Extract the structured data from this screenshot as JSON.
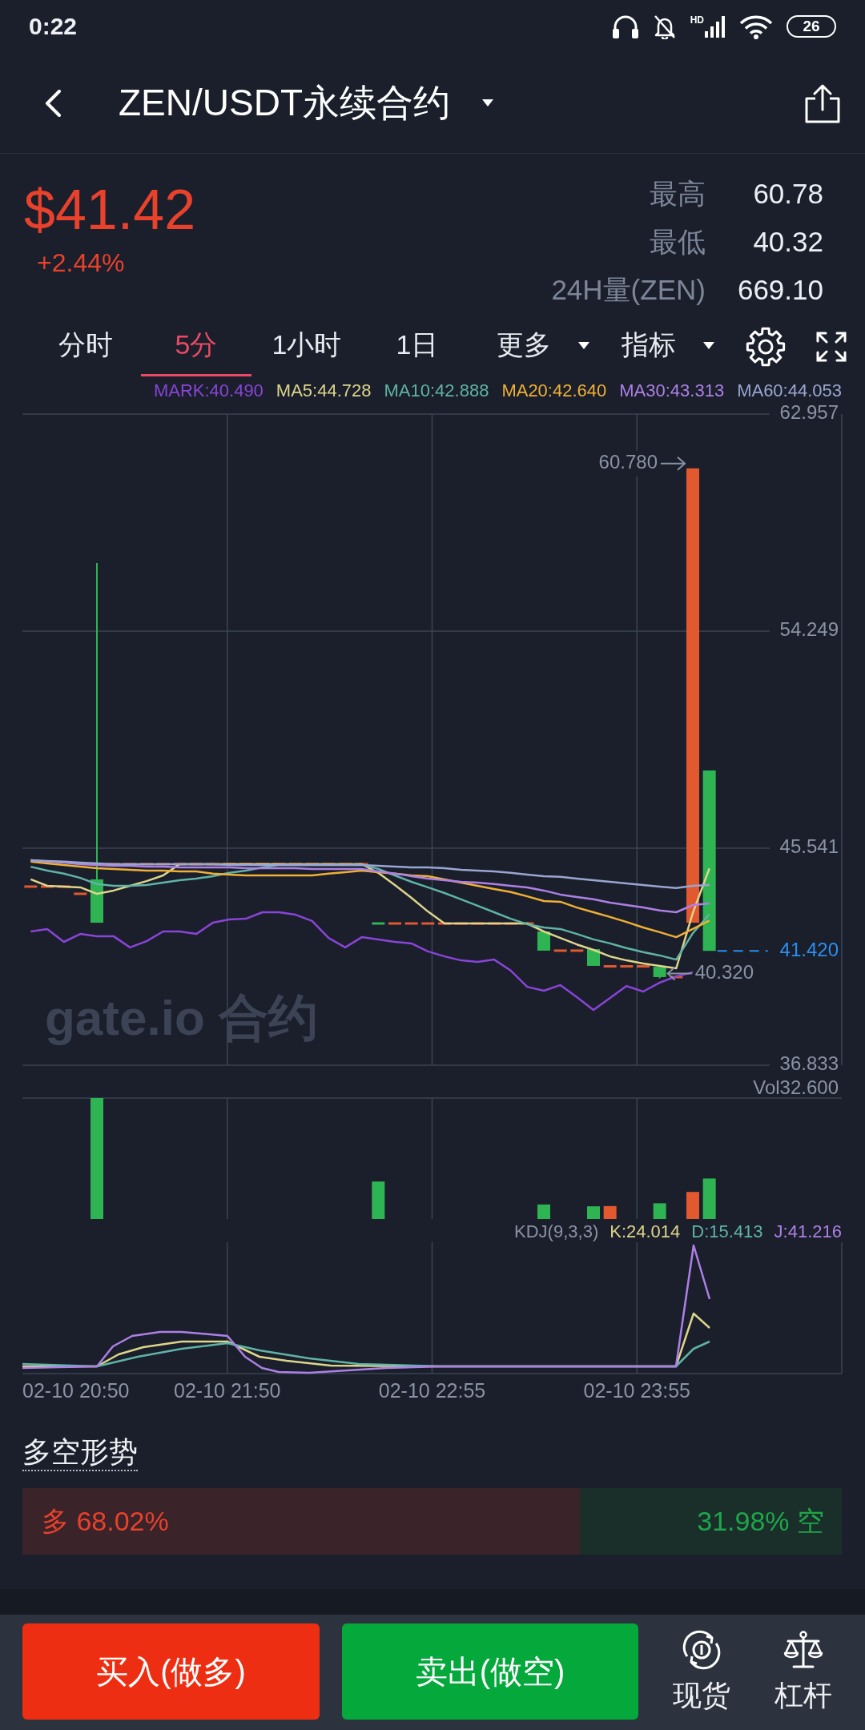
{
  "status_bar": {
    "time": "0:22",
    "network_label": "HD",
    "battery": "26"
  },
  "header": {
    "title": "ZEN/USDT永续合约"
  },
  "ticker": {
    "price": "$41.42",
    "change": "+2.44%",
    "stats": [
      {
        "label": "最高",
        "value": "60.78"
      },
      {
        "label": "最低",
        "value": "40.32"
      },
      {
        "label": "24H量(ZEN)",
        "value": "669.10"
      }
    ]
  },
  "tabs": [
    {
      "label": "分时",
      "kind": "tab",
      "selected": false
    },
    {
      "label": "5分",
      "kind": "tab",
      "selected": true
    },
    {
      "label": "1小时",
      "kind": "tab",
      "selected": false
    },
    {
      "label": "1日",
      "kind": "tab",
      "selected": false
    },
    {
      "label": "更多",
      "kind": "dropdown",
      "selected": false
    },
    {
      "label": "指标",
      "kind": "dropdown",
      "selected": false
    }
  ],
  "price_chart": {
    "watermark": "gate.io 合约",
    "price_marks": [
      {
        "kind": "high",
        "label": "60.780"
      },
      {
        "kind": "low",
        "label": "40.320"
      },
      {
        "kind": "last",
        "label": "41.420"
      }
    ],
    "chart_data": {
      "type": "line",
      "grid": true,
      "categories": [
        null,
        null,
        null,
        null,
        null,
        null,
        null,
        null,
        null,
        null,
        null,
        null,
        null,
        null,
        null,
        null,
        null,
        null,
        null,
        null,
        null,
        null,
        null,
        null,
        null,
        null,
        null,
        null,
        null,
        null,
        null,
        null,
        null,
        null,
        null,
        null,
        null,
        null,
        null,
        null,
        null,
        null
      ],
      "ylim": [
        36.833,
        62.957
      ],
      "yticks": [
        62.957,
        54.249,
        45.541,
        36.833
      ],
      "series": [
        {
          "name": "MARK:40.490",
          "color": "#8a44d8",
          "values": [
            42.2,
            42.3,
            41.78,
            42.1,
            42.01,
            42.01,
            41.56,
            41.81,
            42.2,
            42.2,
            42.1,
            42.55,
            42.68,
            42.71,
            42.97,
            42.97,
            42.87,
            42.62,
            41.94,
            41.56,
            41.97,
            41.88,
            41.78,
            41.72,
            41.4,
            41.2,
            41.04,
            40.98,
            41.07,
            40.63,
            39.98,
            39.82,
            40.05,
            39.56,
            39.05,
            39.53,
            40.01,
            39.79,
            40.15,
            40.4,
            40.56,
            null
          ]
        },
        {
          "name": "MA5:44.728",
          "color": "#ddd58a",
          "values": [
            44.29,
            44.03,
            44.0,
            43.97,
            43.71,
            43.84,
            44.03,
            44.22,
            44.45,
            44.9,
            44.9,
            44.9,
            44.9,
            44.9,
            44.9,
            44.9,
            44.9,
            44.9,
            44.9,
            44.9,
            44.9,
            44.55,
            44.06,
            43.55,
            43.0,
            42.52,
            42.52,
            42.52,
            42.52,
            42.52,
            42.52,
            42.2,
            41.94,
            41.68,
            41.46,
            41.2,
            41.04,
            40.91,
            40.82,
            40.72,
            42.94,
            44.73
          ]
        },
        {
          "name": "MA10:42.888",
          "color": "#5fb3a7",
          "values": [
            44.8,
            44.64,
            44.52,
            44.35,
            44.1,
            44.03,
            44.03,
            44.06,
            44.16,
            44.26,
            44.32,
            44.42,
            44.55,
            44.64,
            44.77,
            44.87,
            44.87,
            44.87,
            44.87,
            44.87,
            44.87,
            44.71,
            44.45,
            44.19,
            43.97,
            43.74,
            43.49,
            43.23,
            42.97,
            42.71,
            42.49,
            42.36,
            42.3,
            42.1,
            41.88,
            41.72,
            41.53,
            41.37,
            41.24,
            41.07,
            42.13,
            42.89
          ]
        },
        {
          "name": "MA20:42.640",
          "color": "#f0b035",
          "values": [
            45.0,
            44.93,
            44.87,
            44.8,
            44.74,
            44.71,
            44.67,
            44.64,
            44.64,
            44.61,
            44.61,
            44.52,
            44.48,
            44.45,
            44.45,
            44.45,
            44.45,
            44.45,
            44.52,
            44.58,
            44.64,
            44.58,
            44.52,
            44.45,
            44.42,
            44.29,
            44.16,
            44.03,
            43.9,
            43.78,
            43.61,
            43.42,
            43.39,
            43.16,
            42.97,
            42.78,
            42.58,
            42.36,
            42.17,
            41.97,
            42.3,
            42.64
          ]
        },
        {
          "name": "MA30:43.313",
          "color": "#ad80e6",
          "values": [
            45.06,
            45.0,
            44.96,
            44.9,
            44.87,
            44.83,
            44.83,
            44.8,
            44.8,
            44.77,
            44.77,
            44.77,
            44.77,
            44.74,
            44.74,
            44.74,
            44.74,
            44.71,
            44.71,
            44.71,
            44.71,
            44.61,
            44.52,
            44.42,
            44.32,
            44.26,
            44.19,
            44.16,
            44.1,
            44.03,
            43.97,
            43.84,
            43.68,
            43.58,
            43.49,
            43.36,
            43.26,
            43.16,
            43.04,
            42.97,
            43.26,
            43.32
          ]
        },
        {
          "name": "MA60:44.053",
          "color": "#9aa6d2",
          "values": [
            45.06,
            45.03,
            45.0,
            44.96,
            44.93,
            44.9,
            44.9,
            44.9,
            44.9,
            44.9,
            44.9,
            44.9,
            44.87,
            44.87,
            44.87,
            44.87,
            44.87,
            44.87,
            44.87,
            44.87,
            44.87,
            44.83,
            44.8,
            44.77,
            44.77,
            44.74,
            44.67,
            44.64,
            44.61,
            44.55,
            44.48,
            44.42,
            44.39,
            44.32,
            44.26,
            44.19,
            44.13,
            44.06,
            44.0,
            43.94,
            44.03,
            44.06
          ]
        }
      ]
    }
  },
  "volume_chart": {
    "label": "Vol32.600"
  },
  "kdj_chart": {
    "legend": [
      {
        "label": "KDJ(9,3,3)",
        "color": "#8a93a5"
      },
      {
        "label": "K:24.014",
        "color": "#ddd58a"
      },
      {
        "label": "D:15.413",
        "color": "#5fb3a7"
      },
      {
        "label": "J:41.216",
        "color": "#ad80e6"
      }
    ]
  },
  "time_axis": [
    "02-10 20:50",
    "02-10 21:50",
    "02-10 22:55",
    "02-10 23:55"
  ],
  "sentiment": {
    "title": "多空形势",
    "long_label": "多 68.02%",
    "short_label": "31.98% 空",
    "level": 0.6802
  },
  "actions": [
    {
      "label": "买入(做多)",
      "kind": "buy"
    },
    {
      "label": "卖出(做空)",
      "kind": "sell"
    }
  ],
  "nav": [
    {
      "label": "现货",
      "kind": "spot"
    },
    {
      "label": "杠杆",
      "kind": "margin"
    }
  ]
}
